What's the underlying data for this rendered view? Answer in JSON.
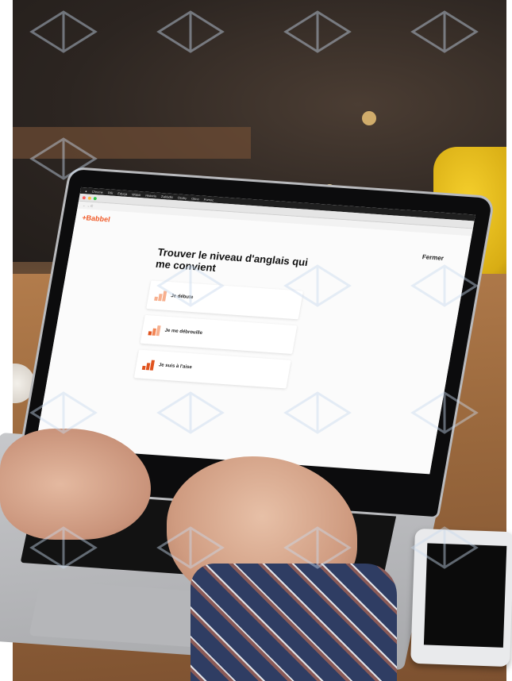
{
  "menubar": {
    "items": [
      "Chrome",
      "Plik",
      "Edycja",
      "Widok",
      "Historia",
      "Zakładki",
      "Osoby",
      "Okno",
      "Pomoc"
    ]
  },
  "app": {
    "brand": "+Babbel",
    "close_label": "Fermer",
    "heading": "Trouver le niveau d'anglais qui me convient",
    "options": [
      {
        "label": "Je débute"
      },
      {
        "label": "Je me débrouille"
      },
      {
        "label": "Je suis à l'aise"
      }
    ]
  },
  "colors": {
    "brand": "#f05a28",
    "bar_light": "#f7b08f",
    "bar_mid": "#f28656",
    "bar_dark": "#e0531e"
  }
}
